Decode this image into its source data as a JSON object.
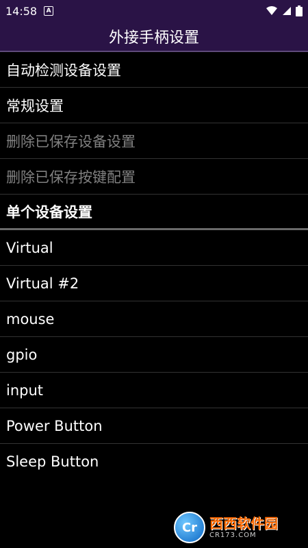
{
  "status_bar": {
    "time": "14:58",
    "notification_icon": "A"
  },
  "title": "外接手柄设置",
  "menu": [
    {
      "label": "自动检测设备设置"
    },
    {
      "label": "常规设置"
    },
    {
      "label": "删除已保存设备设置",
      "enabled": false
    },
    {
      "label": "删除已保存按键配置",
      "enabled": false
    },
    {
      "label": "单个设备设置",
      "section_header": true
    },
    {
      "label": "Virtual"
    },
    {
      "label": "Virtual #2"
    },
    {
      "label": "mouse"
    },
    {
      "label": "gpio"
    },
    {
      "label": "input"
    },
    {
      "label": "Power Button"
    },
    {
      "label": "Sleep Button"
    }
  ],
  "watermark": {
    "logo": "Cr",
    "main": "西西软件园",
    "sub": "CR173.COM"
  }
}
